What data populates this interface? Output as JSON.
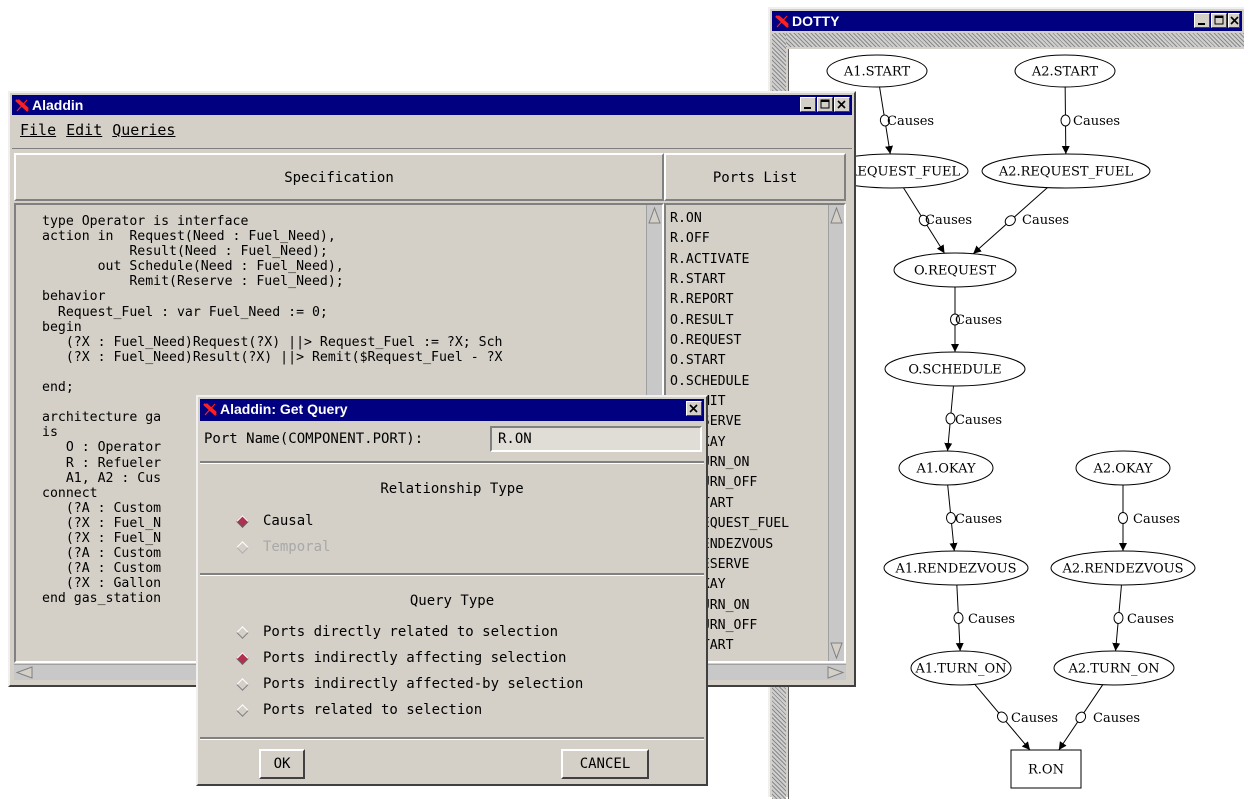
{
  "dotty": {
    "title": "DOTTY",
    "nodes": [
      {
        "id": "a1start",
        "label": "A1.START"
      },
      {
        "id": "a2start",
        "label": "A2.START"
      },
      {
        "id": "a1req",
        "label": "A1.REQUEST_FUEL"
      },
      {
        "id": "a2req",
        "label": "A2.REQUEST_FUEL"
      },
      {
        "id": "oreq",
        "label": "O.REQUEST"
      },
      {
        "id": "osched",
        "label": "O.SCHEDULE"
      },
      {
        "id": "a1okay",
        "label": "A1.OKAY"
      },
      {
        "id": "a2okay",
        "label": "A2.OKAY"
      },
      {
        "id": "a1rend",
        "label": "A1.RENDEZVOUS"
      },
      {
        "id": "a2rend",
        "label": "A2.RENDEZVOUS"
      },
      {
        "id": "a1turn",
        "label": "A1.TURN_ON"
      },
      {
        "id": "a2turn",
        "label": "A2.TURN_ON"
      },
      {
        "id": "ron",
        "label": "R.ON"
      }
    ],
    "edges": [
      {
        "from": "a1start",
        "to": "a1req",
        "label": "Causes"
      },
      {
        "from": "a2start",
        "to": "a2req",
        "label": "Causes"
      },
      {
        "from": "a1req",
        "to": "oreq",
        "label": "Causes"
      },
      {
        "from": "a2req",
        "to": "oreq",
        "label": "Causes"
      },
      {
        "from": "oreq",
        "to": "osched",
        "label": "Causes"
      },
      {
        "from": "osched",
        "to": "a1okay",
        "label": "Causes"
      },
      {
        "from": "a1okay",
        "to": "a1rend",
        "label": "Causes"
      },
      {
        "from": "a2okay",
        "to": "a2rend",
        "label": "Causes"
      },
      {
        "from": "a1rend",
        "to": "a1turn",
        "label": "Causes"
      },
      {
        "from": "a2rend",
        "to": "a2turn",
        "label": "Causes"
      },
      {
        "from": "a1turn",
        "to": "ron",
        "label": "Causes"
      },
      {
        "from": "a2turn",
        "to": "ron",
        "label": "Causes"
      }
    ]
  },
  "aladdin": {
    "title": "Aladdin",
    "menu": {
      "file": "File",
      "edit": "Edit",
      "queries": "Queries"
    },
    "spec_header": "Specification",
    "ports_header": "Ports List",
    "spec_lines": [
      "type Operator is interface",
      "action in  Request(Need : Fuel_Need),",
      "           Result(Need : Fuel_Need);",
      "       out Schedule(Need : Fuel_Need),",
      "           Remit(Reserve : Fuel_Need);",
      "behavior",
      "  Request_Fuel : var Fuel_Need := 0;",
      "begin",
      "   (?X : Fuel_Need)Request(?X) ||> Request_Fuel := ?X; Sch",
      "   (?X : Fuel_Need)Result(?X) ||> Remit($Request_Fuel - ?X",
      "",
      "end;",
      "",
      "architecture ga",
      "is",
      "   O : Operator",
      "   R : Refueler",
      "   A1, A2 : Cus",
      "connect",
      "   (?A : Custom",
      "   (?X : Fuel_N",
      "   (?X : Fuel_N",
      "   (?A : Custom",
      "   (?A : Custom",
      "   (?X : Gallon",
      "end gas_station"
    ],
    "ports": [
      "R.ON",
      "R.OFF",
      "R.ACTIVATE",
      "R.START",
      "R.REPORT",
      "O.RESULT",
      "O.REQUEST",
      "O.START",
      "O.SCHEDULE",
      "O.REMIT",
      "O.RESERVE",
      "A1.OKAY",
      "A1.TURN_ON",
      "A1.TURN_OFF",
      "A1.START",
      "A1.REQUEST_FUEL",
      "A1.RENDEZVOUS",
      "A1.RESERVE",
      "A2.OKAY",
      "A2.TURN_ON",
      "A2.TURN_OFF",
      "A2.START"
    ]
  },
  "query": {
    "title": "Aladdin: Get Query",
    "port_label": "Port Name(COMPONENT.PORT):",
    "port_value": "R.ON",
    "relationship_header": "Relationship Type",
    "relationship_options": [
      {
        "label": "Causal",
        "selected": true,
        "disabled": false
      },
      {
        "label": "Temporal",
        "selected": false,
        "disabled": true
      }
    ],
    "query_header": "Query Type",
    "query_options": [
      {
        "label": "Ports directly related to selection",
        "selected": false
      },
      {
        "label": "Ports indirectly affecting selection",
        "selected": true
      },
      {
        "label": "Ports indirectly affected-by selection",
        "selected": false
      },
      {
        "label": "Ports related to selection",
        "selected": false
      }
    ],
    "ok_label": "OK",
    "cancel_label": "CANCEL"
  },
  "colors": {
    "titlebar": "#000080",
    "selected_radio": "#b03050",
    "window_bg": "#d4d0c8"
  }
}
